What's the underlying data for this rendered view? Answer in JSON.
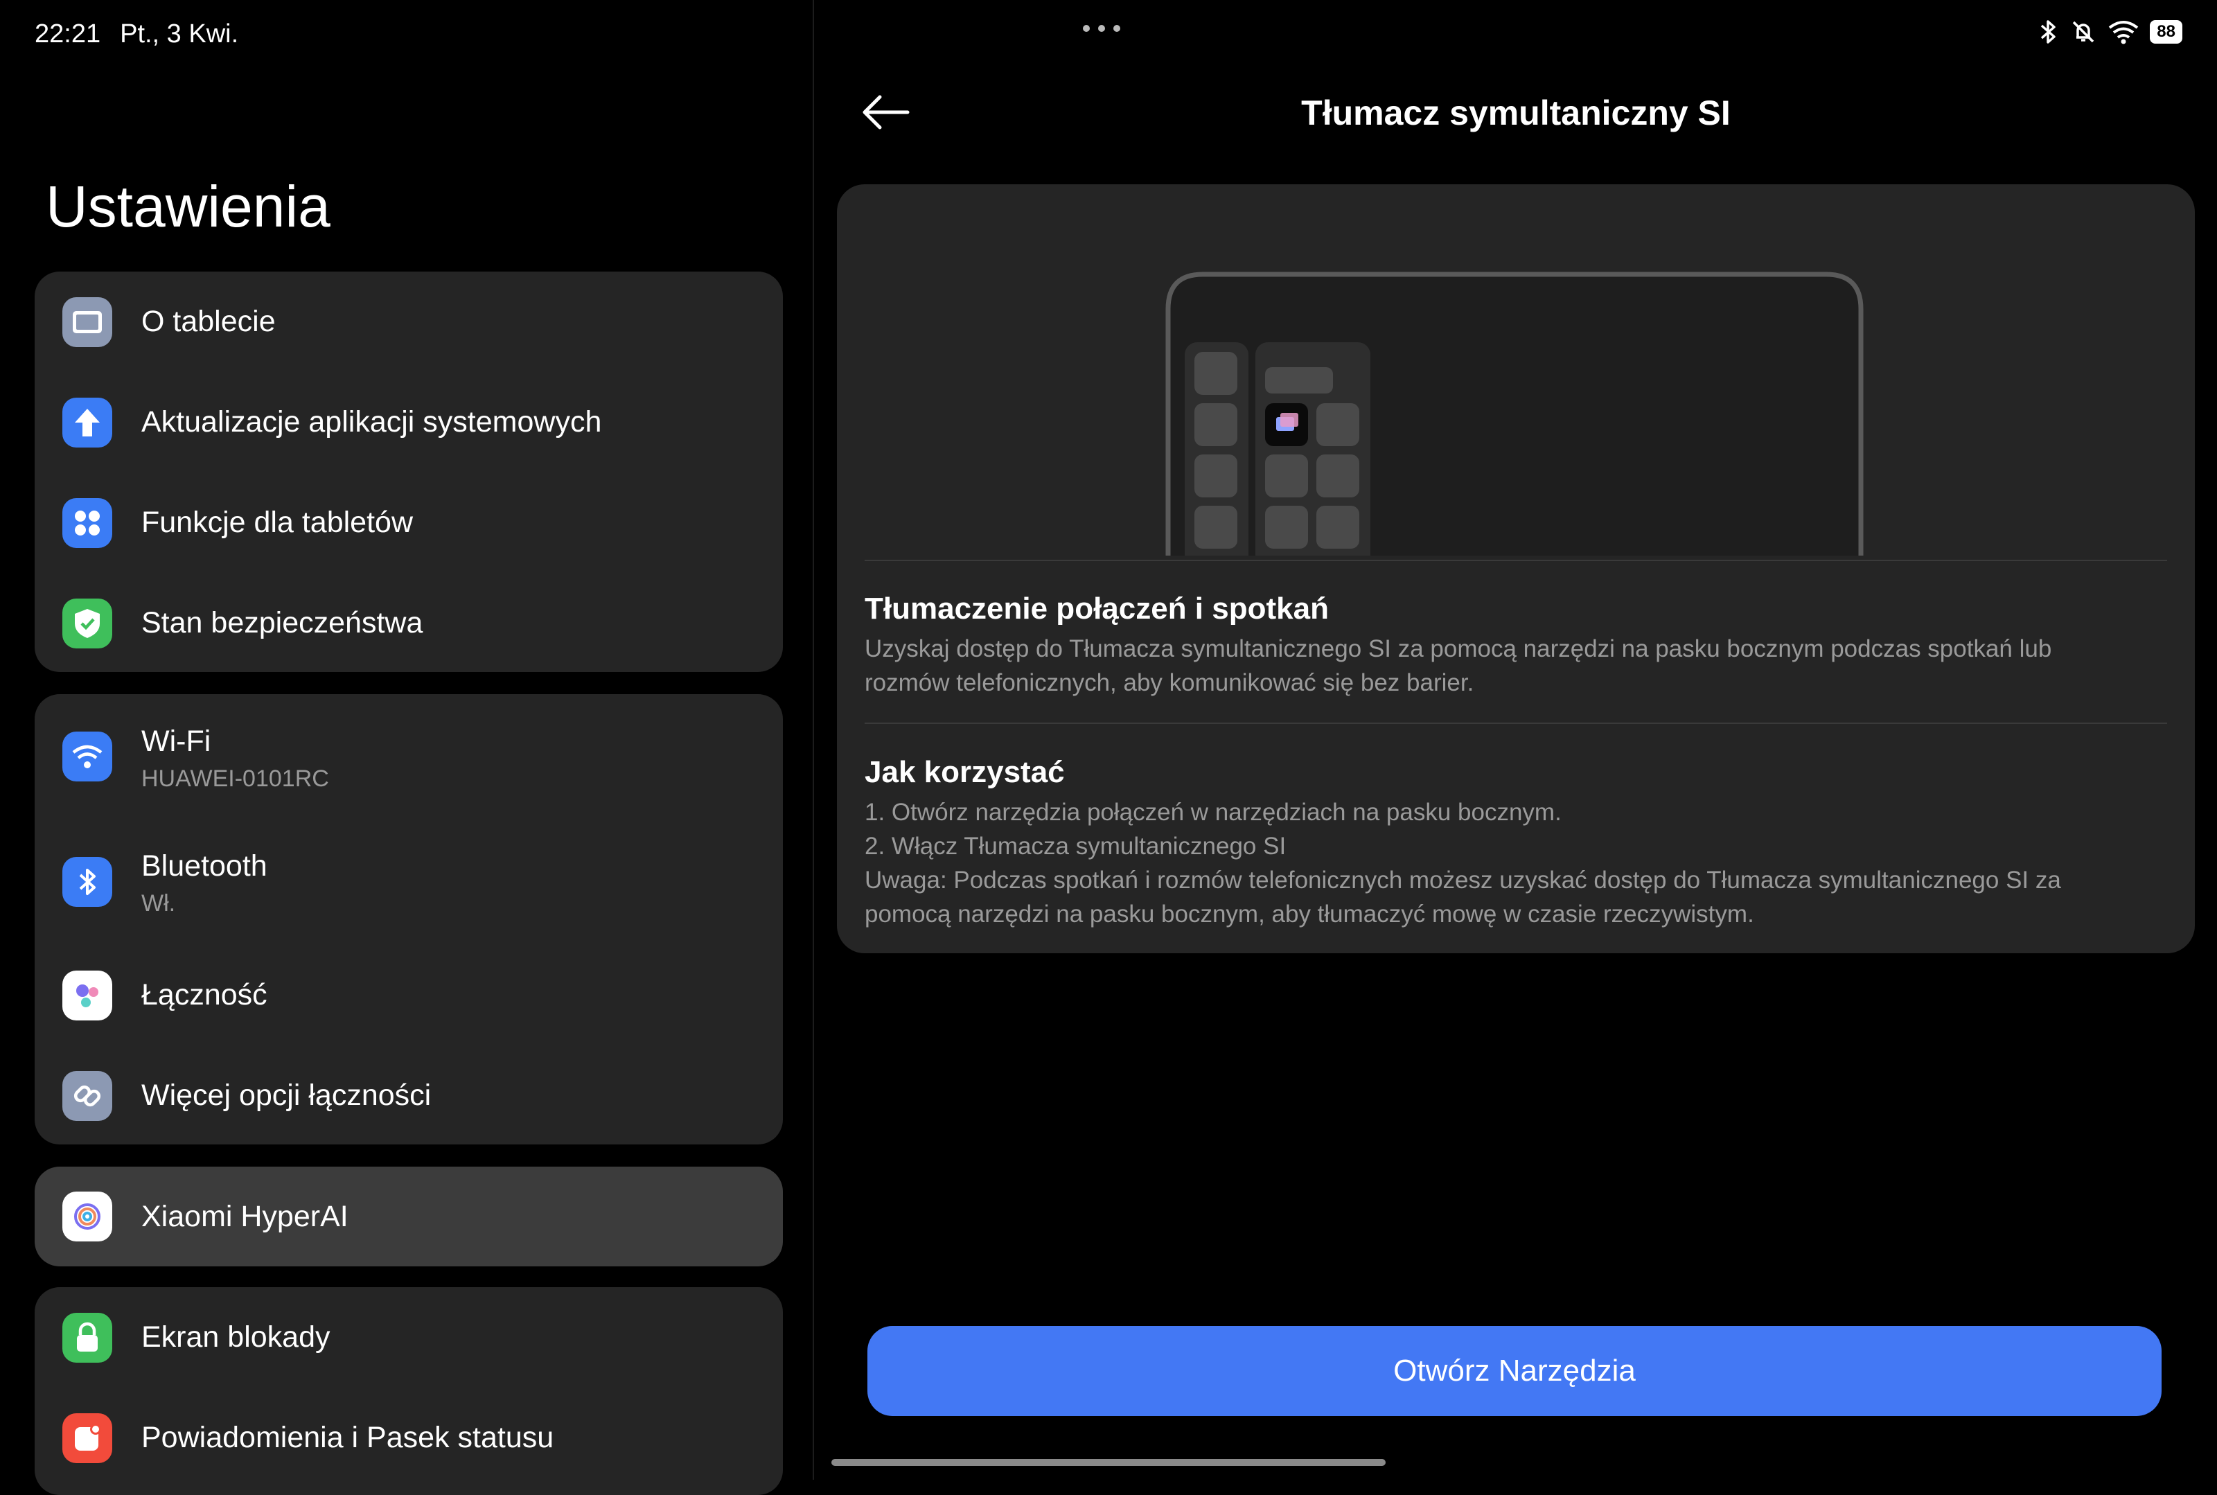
{
  "status": {
    "time": "22:21",
    "date": "Pt., 3 Kwi.",
    "battery": "88"
  },
  "sidebar": {
    "title": "Ustawienia",
    "groups": [
      {
        "items": [
          {
            "label": "O tablecie",
            "icon": "tablet-icon",
            "color": "#8c99b3"
          },
          {
            "label": "Aktualizacje aplikacji systemowych",
            "icon": "arrow-up-icon",
            "color": "#3b7cf5"
          },
          {
            "label": "Funkcje dla tabletów",
            "icon": "grid-dots-icon",
            "color": "#3b7cf5"
          },
          {
            "label": "Stan bezpieczeństwa",
            "icon": "shield-icon",
            "color": "#3fbf5b"
          }
        ]
      },
      {
        "items": [
          {
            "label": "Wi-Fi",
            "sub": "HUAWEI-0101RC",
            "icon": "wifi-icon",
            "color": "#3b7cf5"
          },
          {
            "label": "Bluetooth",
            "sub": "Wł.",
            "icon": "bluetooth-icon",
            "color": "#3b7cf5"
          },
          {
            "label": "Łączność",
            "icon": "connectivity-icon",
            "color": "#ffffff"
          },
          {
            "label": "Więcej opcji łączności",
            "icon": "link-icon",
            "color": "#8c99b3"
          }
        ]
      },
      {
        "items": [
          {
            "label": "Xiaomi HyperAI",
            "icon": "hyperai-icon",
            "color": "#ffffff"
          }
        ]
      },
      {
        "items": [
          {
            "label": "Ekran blokady",
            "icon": "lock-icon",
            "color": "#3fbf5b"
          },
          {
            "label": "Powiadomienia i Pasek statusu",
            "icon": "notification-icon",
            "color": "#f24b3b"
          }
        ]
      }
    ]
  },
  "detail": {
    "title": "Tłumacz symultaniczny SI",
    "section1": {
      "title": "Tłumaczenie połączeń i spotkań",
      "text": "Uzyskaj dostęp do Tłumacza symultanicznego SI za pomocą narzędzi na pasku bocznym podczas spotkań lub rozmów telefonicznych, aby komunikować się bez barier."
    },
    "section2": {
      "title": "Jak korzystać",
      "lines": [
        "1. Otwórz narzędzia połączeń w narzędziach na pasku bocznym.",
        "2. Włącz Tłumacza symultanicznego SI",
        "Uwaga: Podczas spotkań i rozmów telefonicznych możesz uzyskać dostęp do Tłumacza symultanicznego SI za pomocą narzędzi na pasku bocznym, aby tłumaczyć mowę w czasie rzeczywistym."
      ]
    },
    "button": "Otwórz Narzędzia"
  },
  "colors": {
    "accent": "#4378f4",
    "card": "#252525",
    "active": "#3c3c3c"
  }
}
